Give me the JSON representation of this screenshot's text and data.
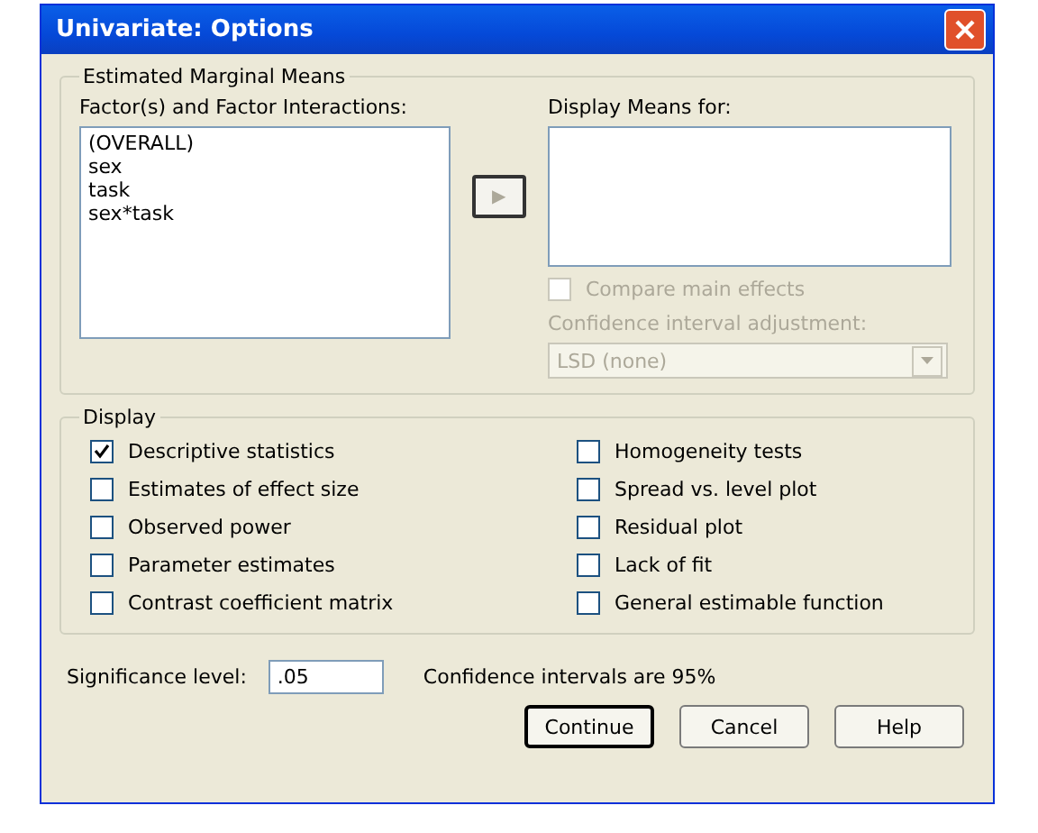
{
  "window": {
    "title": "Univariate: Options"
  },
  "estimated_marginal_means": {
    "title": "Estimated Marginal Means",
    "factors_label": "Factor(s) and Factor Interactions:",
    "factors": [
      {
        "label": "(OVERALL)"
      },
      {
        "label": "sex"
      },
      {
        "label": "task"
      },
      {
        "label": "sex*task"
      }
    ],
    "move_button": {
      "glyph": "▶",
      "disabled": true
    },
    "display_means_label": "Display Means for:",
    "compare_main_effects": {
      "label": "Compare main effects",
      "checked": false,
      "disabled": true
    },
    "adjustment_label": "Confidence interval adjustment:",
    "adjustment": {
      "value": "LSD (none)",
      "disabled": true
    }
  },
  "display": {
    "title": "Display",
    "options": [
      {
        "label": "Descriptive statistics",
        "checked": true
      },
      {
        "label": "Estimates of effect size",
        "checked": false
      },
      {
        "label": "Observed power",
        "checked": false
      },
      {
        "label": "Parameter estimates",
        "checked": false
      },
      {
        "label": "Contrast coefficient matrix",
        "checked": false
      },
      {
        "label": "Homogeneity tests",
        "checked": false
      },
      {
        "label": "Spread vs. level plot",
        "checked": false
      },
      {
        "label": "Residual plot",
        "checked": false
      },
      {
        "label": "Lack of fit",
        "checked": false
      },
      {
        "label": "General estimable function",
        "checked": false
      }
    ]
  },
  "significance": {
    "label": "Significance level:",
    "value": ".05",
    "note": "Confidence intervals are 95%"
  },
  "buttons": [
    {
      "label": "Continue",
      "default": true
    },
    {
      "label": "Cancel",
      "default": false
    },
    {
      "label": "Help",
      "default": false
    }
  ]
}
